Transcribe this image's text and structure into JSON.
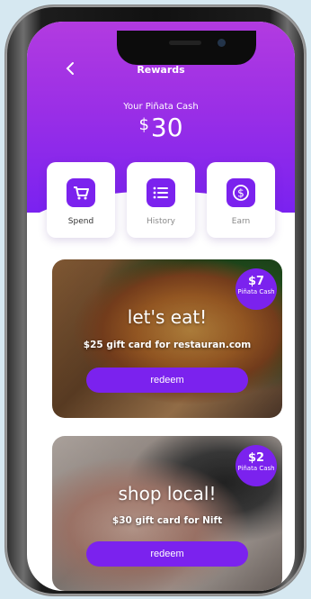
{
  "header": {
    "back_icon": "chevron-left-icon",
    "title": "Rewards",
    "cash_label": "Your Piñata Cash",
    "cash_currency": "$",
    "cash_value": "30"
  },
  "actions": [
    {
      "label": "Spend",
      "icon": "shopping-cart-icon"
    },
    {
      "label": "History",
      "icon": "list-icon"
    },
    {
      "label": "Earn",
      "icon": "dollar-coin-icon"
    }
  ],
  "offers": [
    {
      "heading": "let's eat!",
      "subtitle": "$25 gift card for restauran.com",
      "badge_amount": "$7",
      "badge_unit": "Piñata Cash",
      "button": "redeem"
    },
    {
      "heading": "shop local!",
      "subtitle": "$30 gift card for Nift",
      "badge_amount": "$2",
      "badge_unit": "Piñata Cash",
      "button": "redeem"
    }
  ],
  "colors": {
    "accent": "#7b22ee",
    "header_top": "#b23be0",
    "header_bottom": "#7a22f0",
    "background": "#d6e8f1"
  }
}
